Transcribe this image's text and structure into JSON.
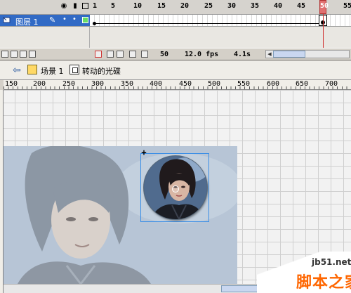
{
  "timeline": {
    "frame_numbers": [
      "1",
      "5",
      "10",
      "15",
      "20",
      "25",
      "30",
      "35",
      "40",
      "45",
      "50",
      "55"
    ],
    "layer_name": "图层 1",
    "status": {
      "current_frame": "50",
      "frame_rate": "12.0 fps",
      "elapsed_time": "4.1s"
    }
  },
  "edit_bar": {
    "scene_label": "场景 1",
    "symbol_label": "转动的光碟"
  },
  "ruler": {
    "labels": [
      "150",
      "200",
      "250",
      "300",
      "350",
      "400",
      "450",
      "500",
      "550",
      "600",
      "650",
      "700"
    ]
  },
  "watermark": {
    "url": "jb51.net",
    "brand": "脚本之家"
  },
  "colors": {
    "layer_highlight": "#316ac5",
    "playhead": "#d03030",
    "selection": "#3a8ee6",
    "watermark_orange": "#ff6600"
  },
  "icons": [
    "eye-icon",
    "lock-icon",
    "outline-icon",
    "layer-icon",
    "pencil-icon",
    "back-arrow-icon",
    "scene-icon",
    "movie-clip-icon"
  ]
}
